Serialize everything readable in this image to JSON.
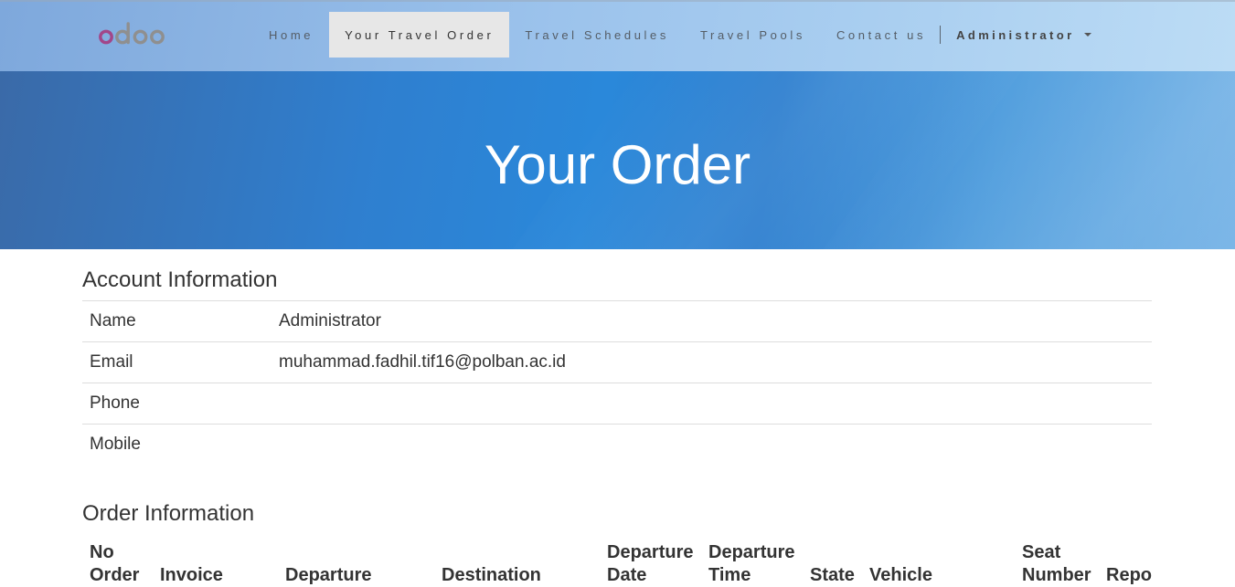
{
  "brand": {
    "logo_text": "odoo",
    "colors": {
      "o1": "#a24689",
      "d": "#8f8f8f",
      "o2": "#8f8f8f",
      "o3": "#8f8f8f"
    }
  },
  "nav": {
    "items": [
      {
        "label": "Home",
        "active": false
      },
      {
        "label": "Your Travel Order",
        "active": true
      },
      {
        "label": "Travel Schedules",
        "active": false
      },
      {
        "label": "Travel Pools",
        "active": false
      },
      {
        "label": "Contact us",
        "active": false
      }
    ],
    "user": {
      "label": "Administrator",
      "icon": "caret-down-icon"
    }
  },
  "hero": {
    "title": "Your Order"
  },
  "account": {
    "title": "Account Information",
    "rows": [
      {
        "label": "Name",
        "value": "Administrator"
      },
      {
        "label": "Email",
        "value": "muhammad.fadhil.tif16@polban.ac.id"
      },
      {
        "label": "Phone",
        "value": ""
      },
      {
        "label": "Mobile",
        "value": ""
      }
    ]
  },
  "order": {
    "title": "Order Information",
    "headers": [
      [
        "No",
        "Order"
      ],
      [
        "Invoice"
      ],
      [
        "Departure"
      ],
      [
        "Destination"
      ],
      [
        "Departure",
        "Date"
      ],
      [
        "Departure",
        "Time"
      ],
      [
        "State"
      ],
      [
        "Vehicle"
      ],
      [
        "Seat",
        "Number"
      ],
      [
        "Repo"
      ]
    ]
  }
}
